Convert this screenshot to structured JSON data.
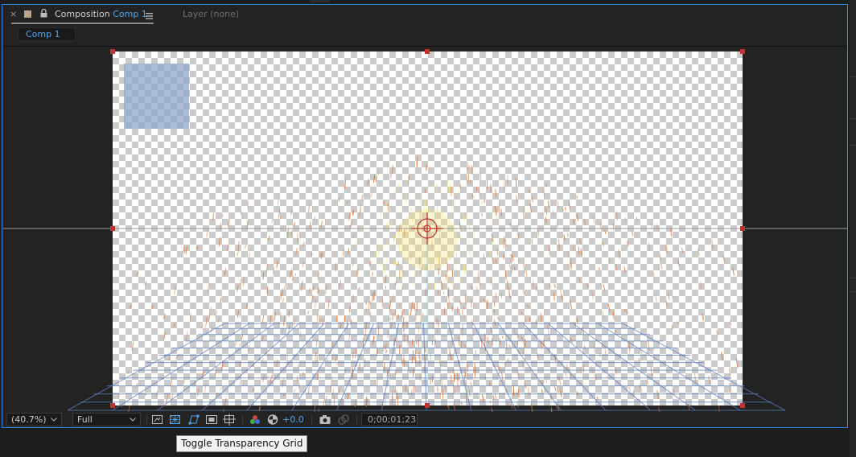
{
  "panel": {
    "close_glyph": "×",
    "tab_prefix": "Composition",
    "tab_comp_name": "Comp 1",
    "layer_tab": "Layer (none)",
    "comp_chip": "Comp 1"
  },
  "icons": {
    "close": "close-icon",
    "swatch": "comp-color-swatch",
    "lock": "lock-icon",
    "panel_menu": "panel-menu-icon"
  },
  "toolbar": {
    "magnification": "(40.7%)",
    "resolution": "Full",
    "exposure": "+0.0",
    "timecode": "0;00;01;23",
    "icons": [
      "always-preview-icon",
      "transparency-grid-icon",
      "mask-shape-path-icon",
      "region-of-interest-icon",
      "grid-guides-icon",
      "show-channel-icon",
      "reset-exposure-icon",
      "snapshot-icon",
      "show-snapshot-icon"
    ]
  },
  "tooltip": "Toggle Transparency Grid",
  "colors": {
    "accent": "#2d8ceb",
    "link_blue": "#4ea5f0",
    "handle_red": "#c0322f",
    "grid_blue": "#5a7fbf",
    "particle_orange": "#e07a3a",
    "particle_yellow": "#f6e27a",
    "layer_box": "#8ba3c8"
  }
}
